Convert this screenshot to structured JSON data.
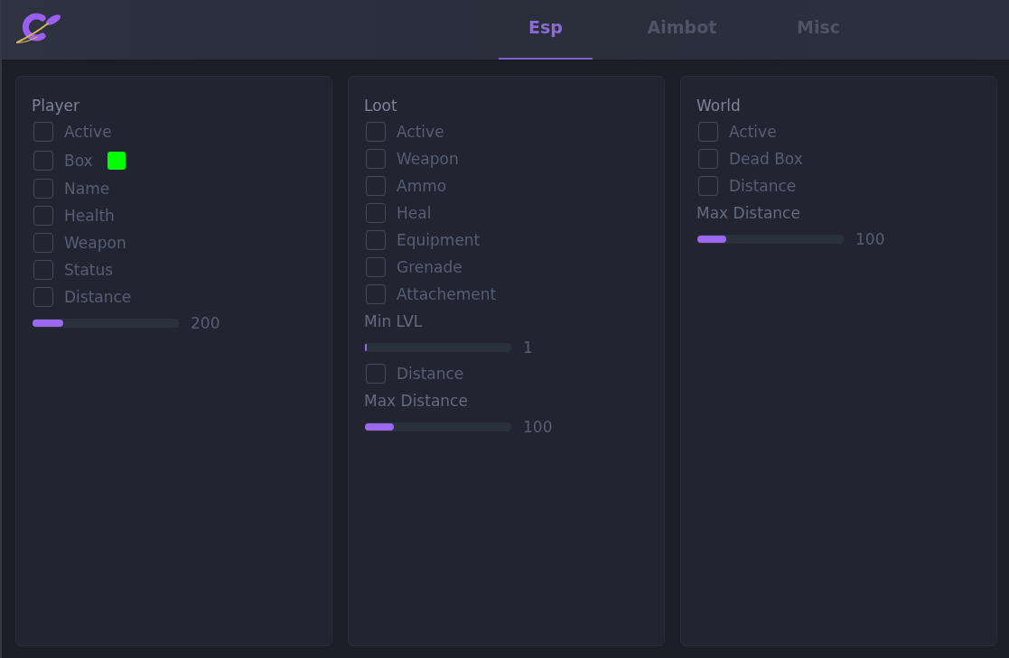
{
  "header": {
    "tabs": [
      {
        "label": "Esp",
        "selected": true
      },
      {
        "label": "Aimbot",
        "selected": false
      },
      {
        "label": "Misc",
        "selected": false
      }
    ]
  },
  "panels": [
    {
      "title": "Player",
      "items": [
        {
          "kind": "checkbox",
          "label": "Active",
          "checked": false
        },
        {
          "kind": "checkbox",
          "label": "Box",
          "checked": false,
          "color": "#00ff00"
        },
        {
          "kind": "checkbox",
          "label": "Name",
          "checked": false
        },
        {
          "kind": "checkbox",
          "label": "Health",
          "checked": false
        },
        {
          "kind": "checkbox",
          "label": "Weapon",
          "checked": false
        },
        {
          "kind": "checkbox",
          "label": "Status",
          "checked": false
        },
        {
          "kind": "checkbox",
          "label": "Distance",
          "checked": false
        },
        {
          "kind": "slider",
          "level": 0.21,
          "reading": "200"
        }
      ]
    },
    {
      "title": "Loot",
      "items": [
        {
          "kind": "checkbox",
          "label": "Active",
          "checked": false
        },
        {
          "kind": "checkbox",
          "label": "Weapon",
          "checked": false
        },
        {
          "kind": "checkbox",
          "label": "Ammo",
          "checked": false
        },
        {
          "kind": "checkbox",
          "label": "Heal",
          "checked": false
        },
        {
          "kind": "checkbox",
          "label": "Equipment",
          "checked": false
        },
        {
          "kind": "checkbox",
          "label": "Grenade",
          "checked": false
        },
        {
          "kind": "checkbox",
          "label": "Attachement",
          "checked": false
        },
        {
          "kind": "label",
          "label": "Min LVL"
        },
        {
          "kind": "slider",
          "level": 0.01,
          "reading": "1"
        },
        {
          "kind": "checkbox",
          "label": "Distance",
          "checked": false
        },
        {
          "kind": "label",
          "label": "Max Distance"
        },
        {
          "kind": "slider",
          "level": 0.2,
          "reading": "100"
        }
      ]
    },
    {
      "title": "World",
      "items": [
        {
          "kind": "checkbox",
          "label": "Active",
          "checked": false
        },
        {
          "kind": "checkbox",
          "label": "Dead Box",
          "checked": false
        },
        {
          "kind": "checkbox",
          "label": "Distance",
          "checked": false
        },
        {
          "kind": "label",
          "label": "Max Distance"
        },
        {
          "kind": "slider",
          "level": 0.2,
          "reading": "100"
        }
      ]
    }
  ]
}
